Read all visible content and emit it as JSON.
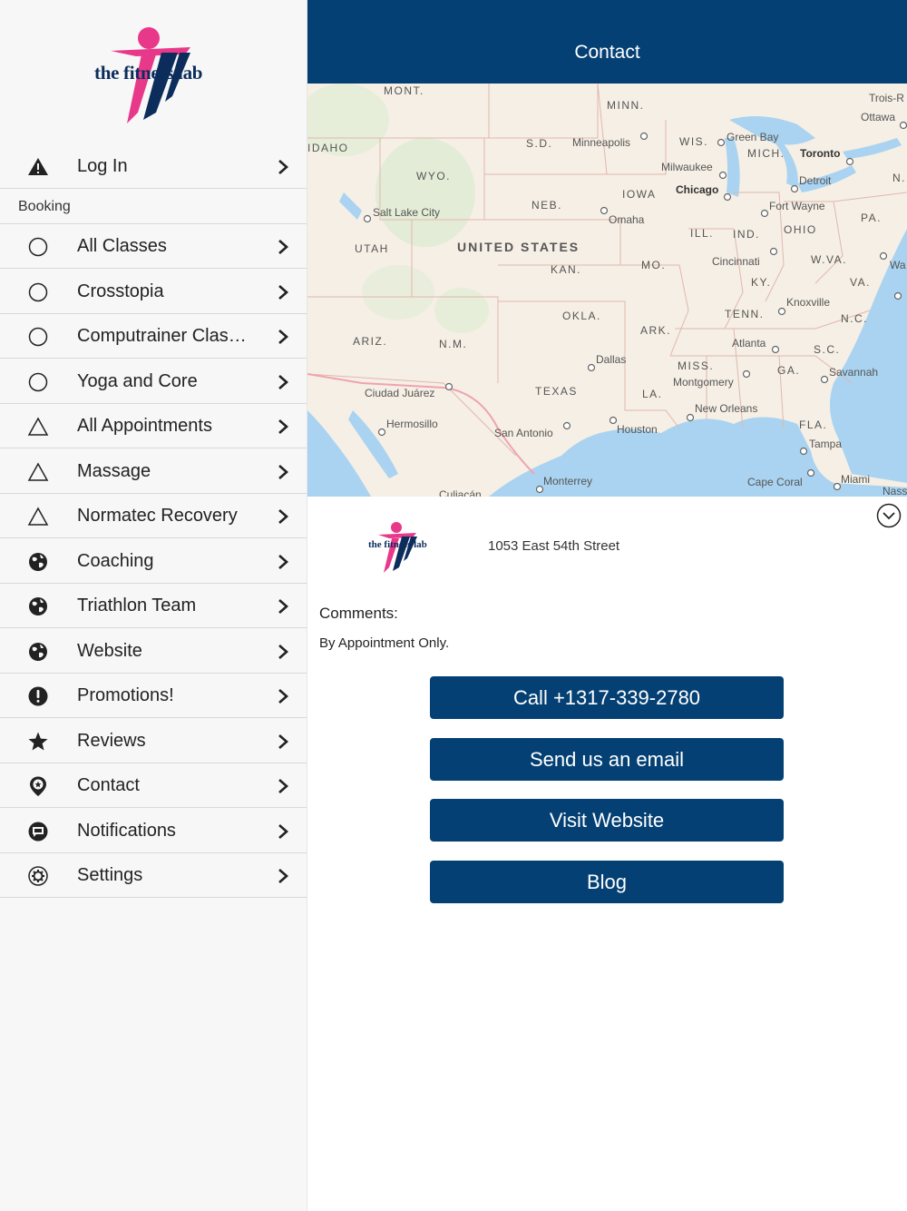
{
  "brand": {
    "logo_text": "the fitness lab"
  },
  "sidebar": {
    "login": {
      "label": "Log In",
      "icon": "warning-icon"
    },
    "booking_header": "Booking",
    "items": [
      {
        "label": "All Classes",
        "icon": "circle-outline-icon"
      },
      {
        "label": "Crosstopia",
        "icon": "circle-outline-icon"
      },
      {
        "label": "Computrainer Clas…",
        "icon": "circle-outline-icon"
      },
      {
        "label": "Yoga and Core",
        "icon": "circle-outline-icon"
      },
      {
        "label": "All Appointments",
        "icon": "triangle-outline-icon"
      },
      {
        "label": "Massage",
        "icon": "triangle-outline-icon"
      },
      {
        "label": "Normatec Recovery",
        "icon": "triangle-outline-icon"
      },
      {
        "label": "Coaching",
        "icon": "globe-icon"
      },
      {
        "label": "Triathlon Team",
        "icon": "globe-icon"
      },
      {
        "label": "Website",
        "icon": "globe-icon"
      },
      {
        "label": "Promotions!",
        "icon": "exclamation-circle-icon"
      },
      {
        "label": "Reviews",
        "icon": "star-icon"
      },
      {
        "label": "Contact",
        "icon": "map-pin-icon"
      },
      {
        "label": "Notifications",
        "icon": "chat-bubble-icon"
      },
      {
        "label": "Settings",
        "icon": "gear-icon"
      }
    ]
  },
  "header": {
    "title": "Contact"
  },
  "map": {
    "country_label": "UNITED STATES",
    "states": [
      "MONT.",
      "IDAHO",
      "WYO.",
      "UTAH",
      "S.D.",
      "NEB.",
      "KAN.",
      "MINN.",
      "IOWA",
      "WIS.",
      "MICH.",
      "ILL.",
      "IND.",
      "OHIO",
      "PA.",
      "MO.",
      "KY.",
      "W.VA.",
      "VA.",
      "TENN.",
      "N.C.",
      "S.C.",
      "OKLA.",
      "ARK.",
      "ARIZ.",
      "N.M.",
      "TEXAS",
      "MISS.",
      "GA.",
      "LA.",
      "FLA.",
      "N."
    ],
    "cities": [
      "Minneapolis",
      "Green Bay",
      "Milwaukee",
      "Chicago",
      "Toronto",
      "Detroit",
      "Ottawa",
      "Trois-R",
      "Salt Lake City",
      "Omaha",
      "Fort Wayne",
      "Cincinnati",
      "Knoxville",
      "Atlanta",
      "Savannah",
      "Montgomery",
      "Dallas",
      "Ciudad Juárez",
      "Hermosillo",
      "San Antonio",
      "Houston",
      "New Orleans",
      "Tampa",
      "Cape Coral",
      "Miami",
      "Monterrey",
      "Culiacán",
      "Wa",
      "Nass"
    ]
  },
  "contact": {
    "address": "1053 East 54th Street",
    "comments_label": "Comments:",
    "comments_text": "By Appointment Only.",
    "buttons": {
      "call": "Call +1317-339-2780",
      "email": "Send us an email",
      "website": "Visit Website",
      "blog": "Blog"
    }
  },
  "colors": {
    "primary": "#044073",
    "logo_pink": "#e8388a",
    "logo_navy": "#0c2d5c"
  }
}
